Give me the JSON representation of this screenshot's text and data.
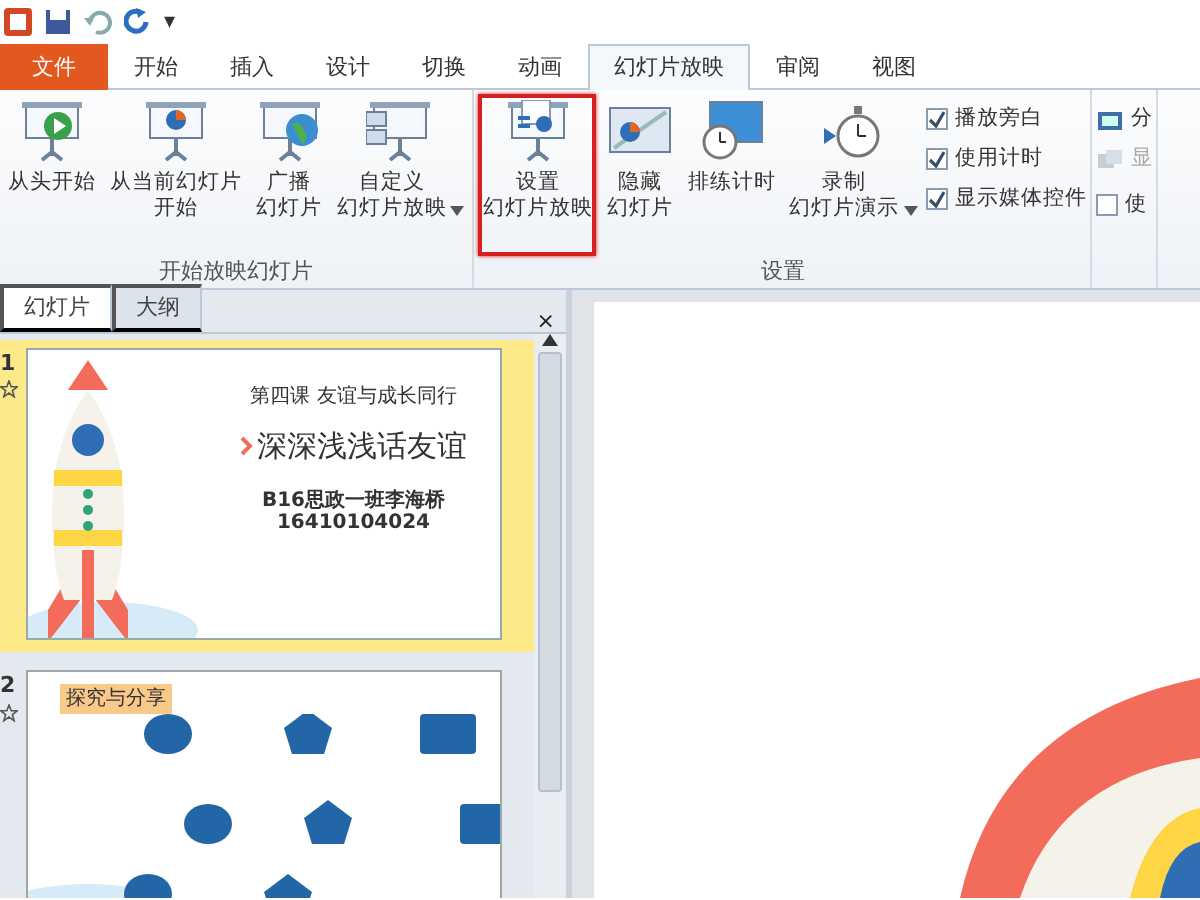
{
  "quick_access": {
    "customize": "▾"
  },
  "ribbon_tabs": [
    {
      "label": "文件",
      "kind": "file",
      "selected": false
    },
    {
      "label": "开始",
      "kind": "tab",
      "selected": false
    },
    {
      "label": "插入",
      "kind": "tab",
      "selected": false
    },
    {
      "label": "设计",
      "kind": "tab",
      "selected": false
    },
    {
      "label": "切换",
      "kind": "tab",
      "selected": false
    },
    {
      "label": "动画",
      "kind": "tab",
      "selected": false
    },
    {
      "label": "幻灯片放映",
      "kind": "tab",
      "selected": true
    },
    {
      "label": "审阅",
      "kind": "tab",
      "selected": false
    },
    {
      "label": "视图",
      "kind": "tab",
      "selected": false
    }
  ],
  "ribbon_groups": [
    {
      "label": "开始放映幻灯片",
      "items": [
        {
          "kind": "large",
          "lines": [
            "从头开始"
          ],
          "dropdown": false,
          "highlighted": false
        },
        {
          "kind": "large",
          "lines": [
            "从当前幻灯片",
            "开始"
          ],
          "dropdown": false,
          "highlighted": false
        },
        {
          "kind": "large",
          "lines": [
            "广播",
            "幻灯片"
          ],
          "dropdown": false,
          "highlighted": false
        },
        {
          "kind": "large",
          "lines": [
            "自定义",
            "幻灯片放映"
          ],
          "dropdown": true,
          "highlighted": false
        }
      ]
    },
    {
      "label": "设置",
      "items": [
        {
          "kind": "large",
          "lines": [
            "设置",
            "幻灯片放映"
          ],
          "dropdown": false,
          "highlighted": true
        },
        {
          "kind": "large",
          "lines": [
            "隐藏",
            "幻灯片"
          ],
          "dropdown": false,
          "highlighted": false
        },
        {
          "kind": "large",
          "lines": [
            "排练计时"
          ],
          "dropdown": false,
          "highlighted": false
        },
        {
          "kind": "large",
          "lines": [
            "录制",
            "幻灯片演示"
          ],
          "dropdown": true,
          "highlighted": false
        },
        {
          "kind": "checks",
          "options": [
            {
              "label": "播放旁白",
              "checked": true
            },
            {
              "label": "使用计时",
              "checked": true
            },
            {
              "label": "显示媒体控件",
              "checked": true
            }
          ]
        }
      ]
    },
    {
      "items": [
        {
          "kind": "small",
          "label": "分",
          "disabled": false
        },
        {
          "kind": "small",
          "label": "显",
          "disabled": true
        },
        {
          "kind": "checks",
          "options": [
            {
              "label": "使",
              "checked": false
            }
          ]
        }
      ]
    }
  ],
  "pane": {
    "tabs": [
      {
        "label": "幻灯片",
        "selected": true
      },
      {
        "label": "大纲",
        "selected": false
      }
    ],
    "close": "×",
    "slides": [
      {
        "number": "1",
        "selected": true,
        "kind": "title",
        "subtitle": "第四课 友谊与成长同行",
        "title": "深深浅浅话友谊",
        "footer": [
          "B16思政一班李海桥",
          "16410104024"
        ]
      },
      {
        "number": "2",
        "selected": false,
        "kind": "diagram",
        "heading": "探究与分享"
      }
    ]
  }
}
